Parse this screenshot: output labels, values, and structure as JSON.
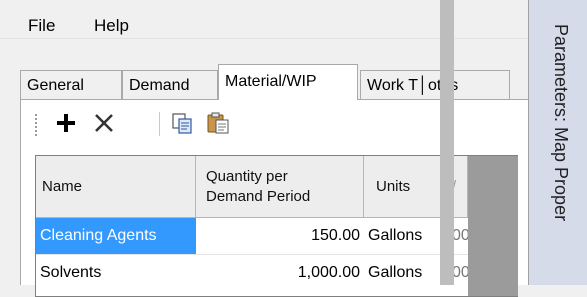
{
  "menu": {
    "items": [
      "File",
      "Help"
    ]
  },
  "tabs": [
    {
      "label": "General",
      "active": false
    },
    {
      "label": "Demand",
      "active": false
    },
    {
      "label": "Material/WIP",
      "active": true
    },
    {
      "label": "Work T│otes",
      "active": false
    }
  ],
  "toolbar": {
    "add_icon": "plus-icon",
    "delete_icon": "x-icon",
    "copy_icon": "copy-icon",
    "paste_icon": "paste-icon"
  },
  "grid": {
    "columns": [
      {
        "label": "Name"
      },
      {
        "label": "Quantity per\nDemand Period"
      },
      {
        "label": "Units"
      },
      {
        "label": "/"
      }
    ],
    "rows": [
      {
        "name": "Cleaning Agents",
        "quantity": "150.00",
        "units": "Gallons",
        "extra": "00",
        "selected": true
      },
      {
        "name": "Solvents",
        "quantity": "1,000.00",
        "units": "Gallons",
        "extra": "00",
        "selected": false
      }
    ]
  },
  "dock": {
    "title": "Parameters: Map Proper"
  },
  "colors": {
    "selection": "#3399ff",
    "dock_bg": "#d6dbe9"
  }
}
